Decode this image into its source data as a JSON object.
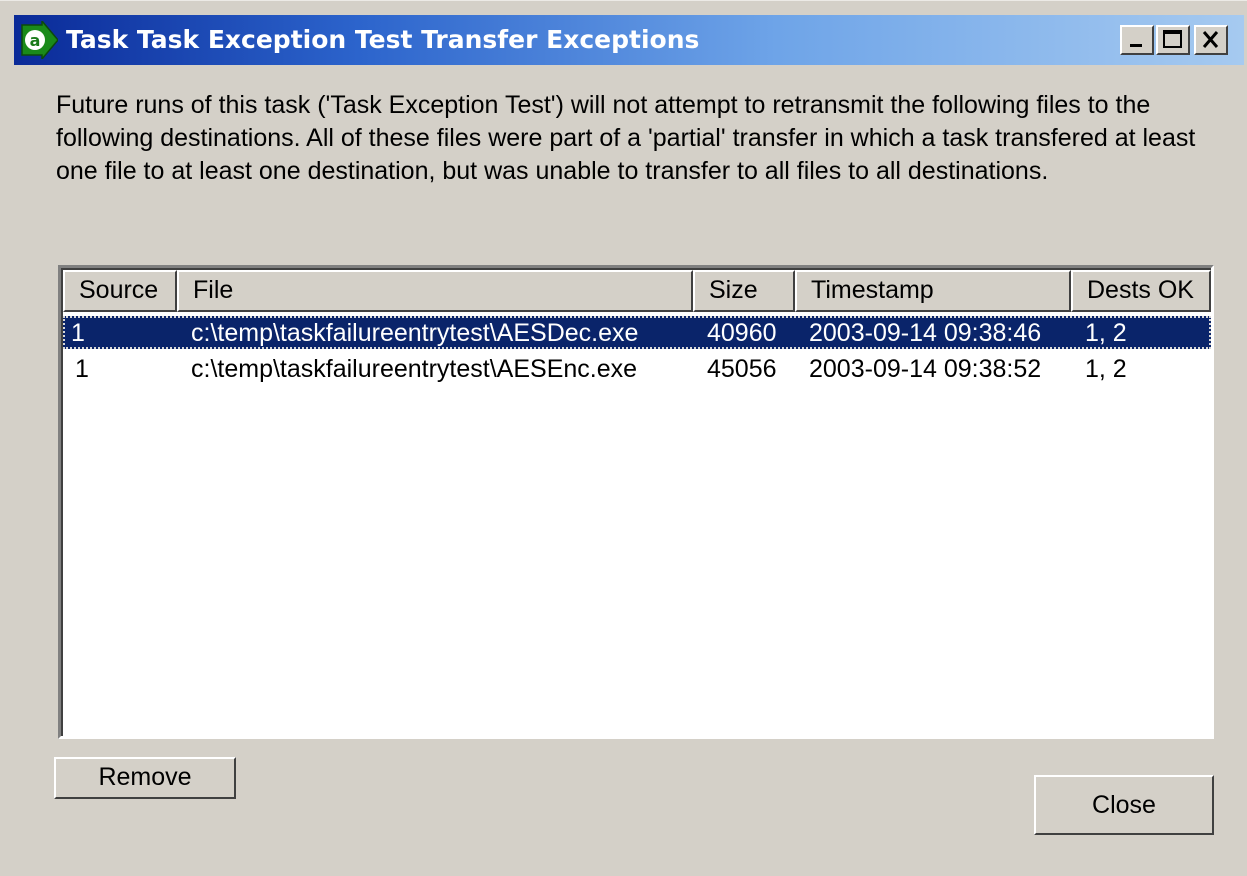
{
  "window": {
    "title": "Task Task Exception Test Transfer Exceptions",
    "icon": "app-arrow-icon",
    "controls": [
      "minimize-icon",
      "maximize-icon",
      "close-icon"
    ]
  },
  "description": "Future runs of this task ('Task Exception Test') will not attempt to retransmit the following files to the following destinations. All of these files were part of a 'partial' transfer in which a task transfered at least one file to at least one destination, but was unable to transfer to all files to all destinations.",
  "table": {
    "columns": [
      "Source",
      "File",
      "Size",
      "Timestamp",
      "Dests OK"
    ],
    "rows": [
      {
        "source": "1",
        "file": "c:\\temp\\taskfailureentrytest\\AESDec.exe",
        "size": "40960",
        "timestamp": "2003-09-14 09:38:46",
        "dests": "1, 2",
        "selected": true
      },
      {
        "source": "1",
        "file": "c:\\temp\\taskfailureentrytest\\AESEnc.exe",
        "size": "45056",
        "timestamp": "2003-09-14 09:38:52",
        "dests": "1, 2",
        "selected": false
      }
    ]
  },
  "buttons": {
    "remove": "Remove",
    "close": "Close"
  },
  "colors": {
    "selection": "#0a246a",
    "face": "#d4d0c8"
  }
}
